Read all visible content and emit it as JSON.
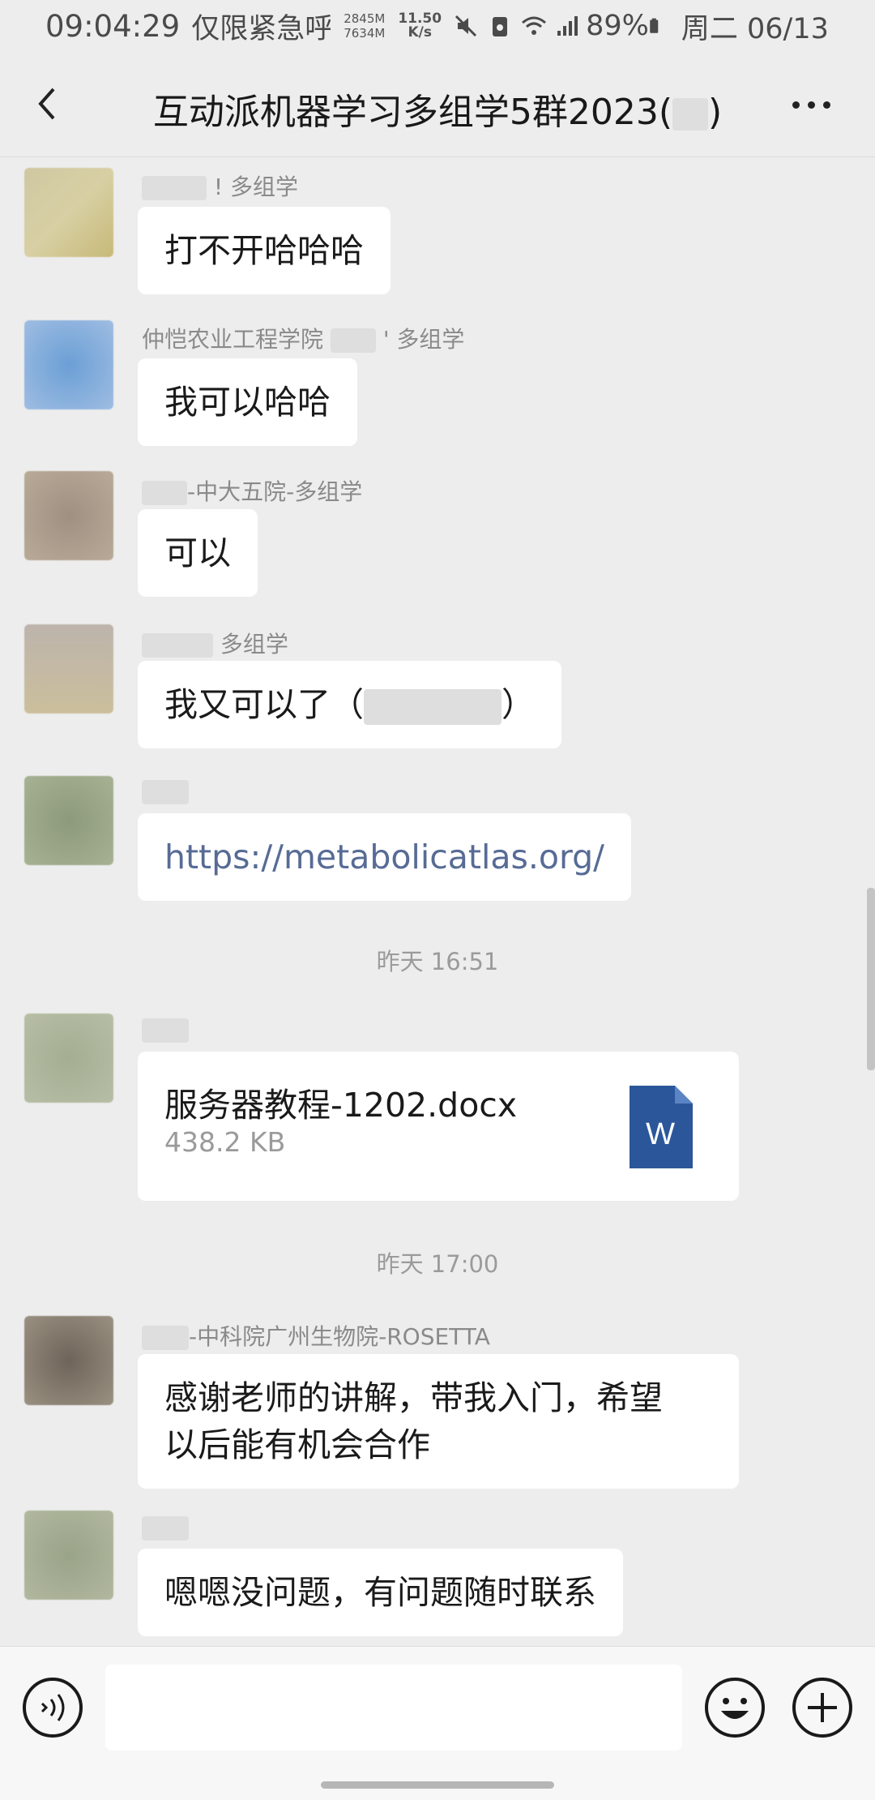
{
  "status_bar": {
    "time": "09:04:29",
    "notice": "仅限紧急呼叫",
    "mem_top": "2845M",
    "mem_bottom": "7634M",
    "speed_value": "11.50",
    "speed_unit": "K/s",
    "battery": "89%",
    "date": "周二 06/13"
  },
  "header": {
    "title": "互动派机器学习多组学5群2023(",
    "title_end": ")"
  },
  "messages": [
    {
      "sender_suffix": "! 多组学",
      "text": "打不开哈哈哈"
    },
    {
      "sender_prefix": "仲恺农业工程学院",
      "sender_suffix": "' 多组学",
      "text": "我可以哈哈"
    },
    {
      "sender_suffix": "-中大五院-多组学",
      "text": "可以"
    },
    {
      "sender_suffix": "多组学",
      "text_start": "我又可以了（",
      "text_end": "）"
    },
    {
      "text": "https://metabolicatlas.org/"
    },
    {
      "sender_suffix": "-中科院广州生物院-ROSETTA",
      "line1": "感谢老师的讲解，带我入门，希望",
      "line2": "以后能有机会合作"
    },
    {
      "text": "嗯嗯没问题，有问题随时联系"
    }
  ],
  "timestamps": [
    "昨天 16:51",
    "昨天 17:00"
  ],
  "file": {
    "name": "服务器教程-1202.docx",
    "size": "438.2 KB",
    "icon_letter": "W"
  },
  "icons": {
    "back": "chevron-left-icon",
    "more": "more-icon",
    "voice": "voice-icon",
    "emoji": "emoji-icon",
    "plus": "plus-icon",
    "file": "word-doc-icon"
  },
  "colors": {
    "link": "#576b95",
    "word_blue": "#2b579a"
  }
}
